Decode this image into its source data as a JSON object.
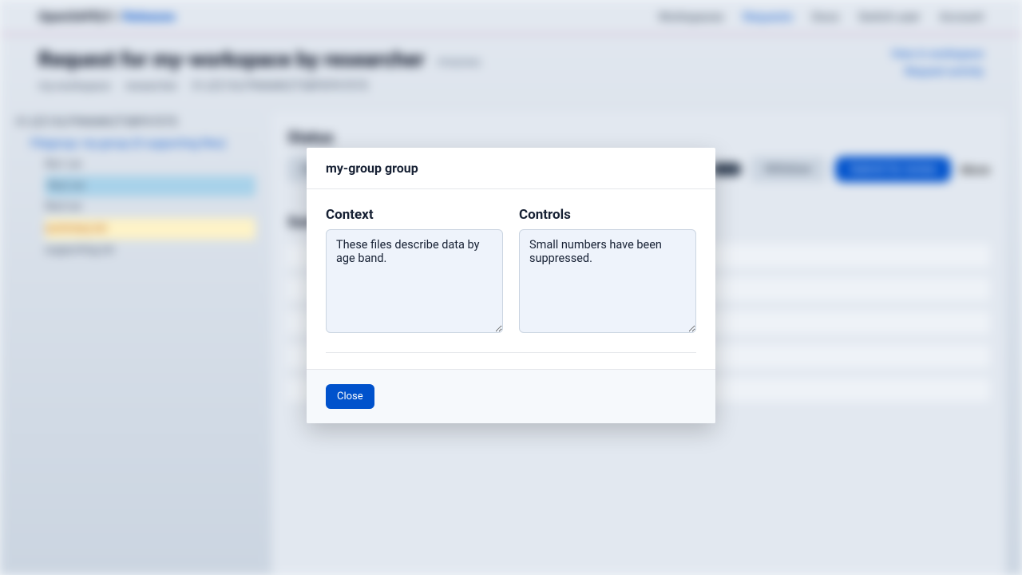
{
  "header": {
    "brand_prefix": "OpenSAFELY",
    "brand_sep": " / ",
    "brand_link": "Releases",
    "nav": {
      "workspaces": "Workspaces",
      "requests": "Requests",
      "docs": "Docs",
      "switch_user": "Switch user",
      "account": "Account"
    }
  },
  "title": {
    "main": "Request for my-workspace by researcher",
    "status_chip": "PENDING",
    "meta_workspace": "my-workspace",
    "meta_user": "researcher",
    "meta_id": "01JZ21XLP9N6MKZTSBPDPX7ETE",
    "link_workspace": "View in workspace",
    "link_activity": "Request activity"
  },
  "tree": {
    "root": "01JZ21XLP9N6MKZTSBPX7ETE",
    "folder": "Filegroup: my-group (0 supporting files)",
    "files": [
      "file1.txt",
      "file2.txt",
      "file3.txt",
      "summary.txt",
      "supporting.txt"
    ]
  },
  "main": {
    "heading": "Status",
    "overview": "Overview",
    "withdraw": "Withdraw",
    "submit": "Submit for review",
    "more": "More",
    "section": "Summary"
  },
  "modal": {
    "title": "my-group group",
    "context_label": "Context",
    "context_value": "These files describe data by age band.",
    "controls_label": "Controls",
    "controls_value": "Small numbers have been suppressed.",
    "close": "Close"
  }
}
